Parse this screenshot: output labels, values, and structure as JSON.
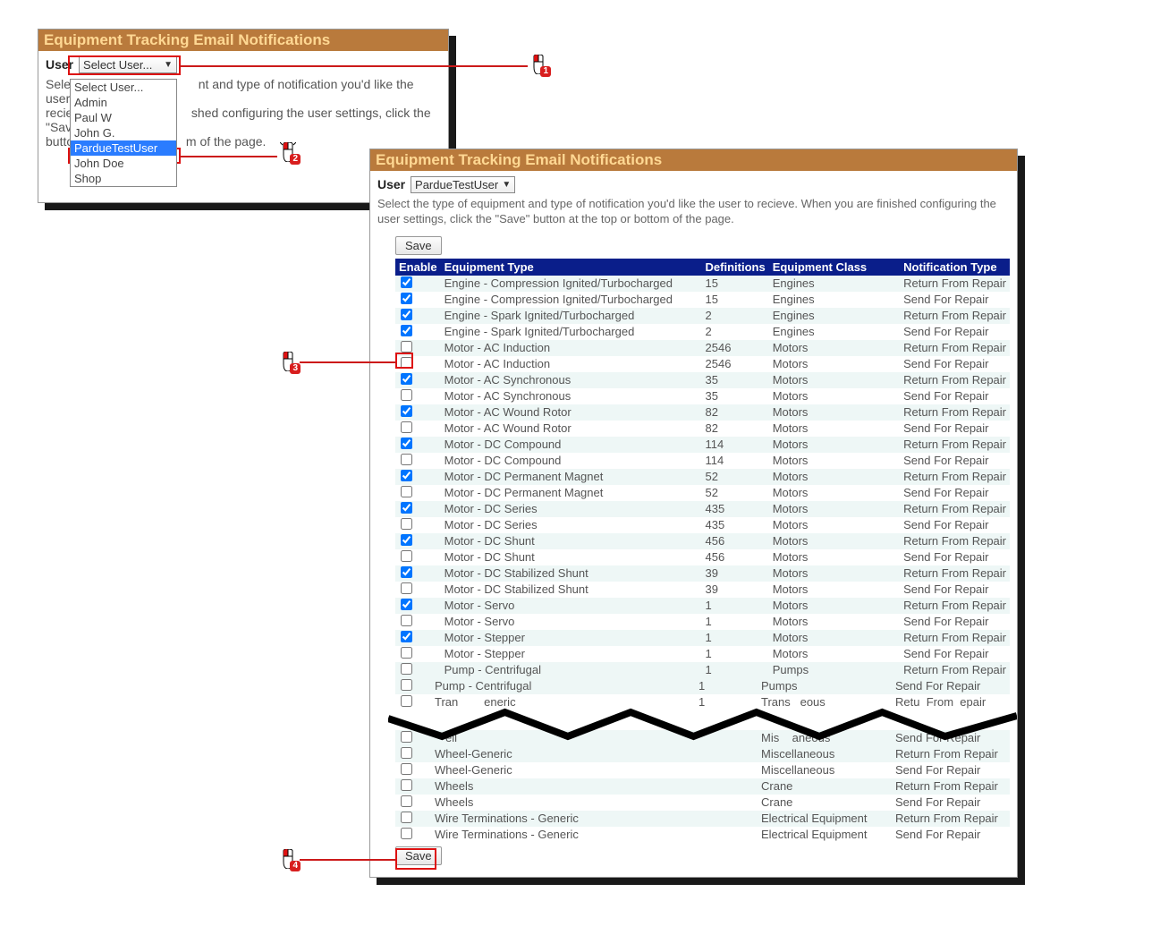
{
  "panel1": {
    "title": "Equipment Tracking Email Notifications",
    "user_label": "User",
    "select_current": "Select User...",
    "instruction_line1_a": "Select",
    "instruction_line1_b": "nt and type of notification you'd like the user to",
    "instruction_line2_a": "recieve",
    "instruction_line2_b": "shed configuring the user settings, click the \"Save\"",
    "instruction_line3_a": "butto",
    "instruction_line3_b": "m of the page.",
    "dropdown": [
      "Select User...",
      "Admin",
      "Paul W",
      "John G.",
      "PardueTestUser",
      "John Doe",
      "Shop"
    ],
    "highlighted_option_index": 4
  },
  "panel2": {
    "title": "Equipment Tracking Email Notifications",
    "user_label": "User",
    "select_current": "PardueTestUser",
    "instruction": "Select the type of equipment and type of notification you'd like the user to recieve. When you are finished configuring the user settings, click the \"Save\" button at the top or bottom of the page.",
    "save_label": "Save",
    "columns": {
      "enable": "Enable",
      "type": "Equipment Type",
      "defs": "Definitions",
      "class": "Equipment Class",
      "notif": "Notification Type"
    },
    "rows_top": [
      {
        "enabled": true,
        "type": "Engine - Compression Ignited/Turbocharged",
        "defs": "15",
        "class": "Engines",
        "notif": "Return From Repair"
      },
      {
        "enabled": true,
        "type": "Engine - Compression Ignited/Turbocharged",
        "defs": "15",
        "class": "Engines",
        "notif": "Send For Repair"
      },
      {
        "enabled": true,
        "type": "Engine - Spark Ignited/Turbocharged",
        "defs": "2",
        "class": "Engines",
        "notif": "Return From Repair"
      },
      {
        "enabled": true,
        "type": "Engine - Spark Ignited/Turbocharged",
        "defs": "2",
        "class": "Engines",
        "notif": "Send For Repair"
      },
      {
        "enabled": false,
        "type": "Motor - AC Induction",
        "defs": "2546",
        "class": "Motors",
        "notif": "Return From Repair"
      },
      {
        "enabled": false,
        "type": "Motor - AC Induction",
        "defs": "2546",
        "class": "Motors",
        "notif": "Send For Repair"
      },
      {
        "enabled": true,
        "type": "Motor - AC Synchronous",
        "defs": "35",
        "class": "Motors",
        "notif": "Return From Repair"
      },
      {
        "enabled": false,
        "type": "Motor - AC Synchronous",
        "defs": "35",
        "class": "Motors",
        "notif": "Send For Repair"
      },
      {
        "enabled": true,
        "type": "Motor - AC Wound Rotor",
        "defs": "82",
        "class": "Motors",
        "notif": "Return From Repair"
      },
      {
        "enabled": false,
        "type": "Motor - AC Wound Rotor",
        "defs": "82",
        "class": "Motors",
        "notif": "Send For Repair"
      },
      {
        "enabled": true,
        "type": "Motor - DC Compound",
        "defs": "114",
        "class": "Motors",
        "notif": "Return From Repair"
      },
      {
        "enabled": false,
        "type": "Motor - DC Compound",
        "defs": "114",
        "class": "Motors",
        "notif": "Send For Repair"
      },
      {
        "enabled": true,
        "type": "Motor - DC Permanent Magnet",
        "defs": "52",
        "class": "Motors",
        "notif": "Return From Repair"
      },
      {
        "enabled": false,
        "type": "Motor - DC Permanent Magnet",
        "defs": "52",
        "class": "Motors",
        "notif": "Send For Repair"
      },
      {
        "enabled": true,
        "type": "Motor - DC Series",
        "defs": "435",
        "class": "Motors",
        "notif": "Return From Repair"
      },
      {
        "enabled": false,
        "type": "Motor - DC Series",
        "defs": "435",
        "class": "Motors",
        "notif": "Send For Repair"
      },
      {
        "enabled": true,
        "type": "Motor - DC Shunt",
        "defs": "456",
        "class": "Motors",
        "notif": "Return From Repair"
      },
      {
        "enabled": false,
        "type": "Motor - DC Shunt",
        "defs": "456",
        "class": "Motors",
        "notif": "Send For Repair"
      },
      {
        "enabled": true,
        "type": "Motor - DC Stabilized Shunt",
        "defs": "39",
        "class": "Motors",
        "notif": "Return From Repair"
      },
      {
        "enabled": false,
        "type": "Motor - DC Stabilized Shunt",
        "defs": "39",
        "class": "Motors",
        "notif": "Send For Repair"
      },
      {
        "enabled": true,
        "type": "Motor - Servo",
        "defs": "1",
        "class": "Motors",
        "notif": "Return From Repair"
      },
      {
        "enabled": false,
        "type": "Motor - Servo",
        "defs": "1",
        "class": "Motors",
        "notif": "Send For Repair"
      },
      {
        "enabled": true,
        "type": "Motor - Stepper",
        "defs": "1",
        "class": "Motors",
        "notif": "Return From Repair"
      },
      {
        "enabled": false,
        "type": "Motor - Stepper",
        "defs": "1",
        "class": "Motors",
        "notif": "Send For Repair"
      },
      {
        "enabled": false,
        "type": "Pump - Centrifugal",
        "defs": "1",
        "class": "Pumps",
        "notif": "Return From Repair"
      }
    ],
    "row_torn_a": {
      "enabled": false,
      "type": "Pump - Centrifugal",
      "defs": "1",
      "class": "Pumps",
      "notif": "Send For Repair"
    },
    "row_torn_b": {
      "type_frag_a": "Tran",
      "type_frag_b": "eneric",
      "defs": "1",
      "class_frag_a": "Trans",
      "class_frag_b": "eous",
      "notif_frag_a": "Retu",
      "notif_frag_b": "From",
      "notif_frag_c": "epair"
    },
    "row_torn_c": {
      "enabled": false,
      "type_frag": "ell",
      "class_frag_a": "Mis",
      "class_frag_b": "aneous",
      "notif": "Send For Repair"
    },
    "rows_bottom": [
      {
        "enabled": false,
        "type": "Wheel-Generic",
        "defs": "",
        "class": "Miscellaneous",
        "notif": "Return From Repair"
      },
      {
        "enabled": false,
        "type": "Wheel-Generic",
        "defs": "",
        "class": "Miscellaneous",
        "notif": "Send For Repair"
      },
      {
        "enabled": false,
        "type": "Wheels",
        "defs": "",
        "class": "Crane",
        "notif": "Return From Repair"
      },
      {
        "enabled": false,
        "type": "Wheels",
        "defs": "",
        "class": "Crane",
        "notif": "Send For Repair"
      },
      {
        "enabled": false,
        "type": "Wire Terminations - Generic",
        "defs": "",
        "class": "Electrical Equipment",
        "notif": "Return From Repair"
      },
      {
        "enabled": false,
        "type": "Wire Terminations - Generic",
        "defs": "",
        "class": "Electrical Equipment",
        "notif": "Send For Repair"
      }
    ]
  },
  "callouts": {
    "c1": "1",
    "c2": "2",
    "c3": "3",
    "c4": "4"
  }
}
